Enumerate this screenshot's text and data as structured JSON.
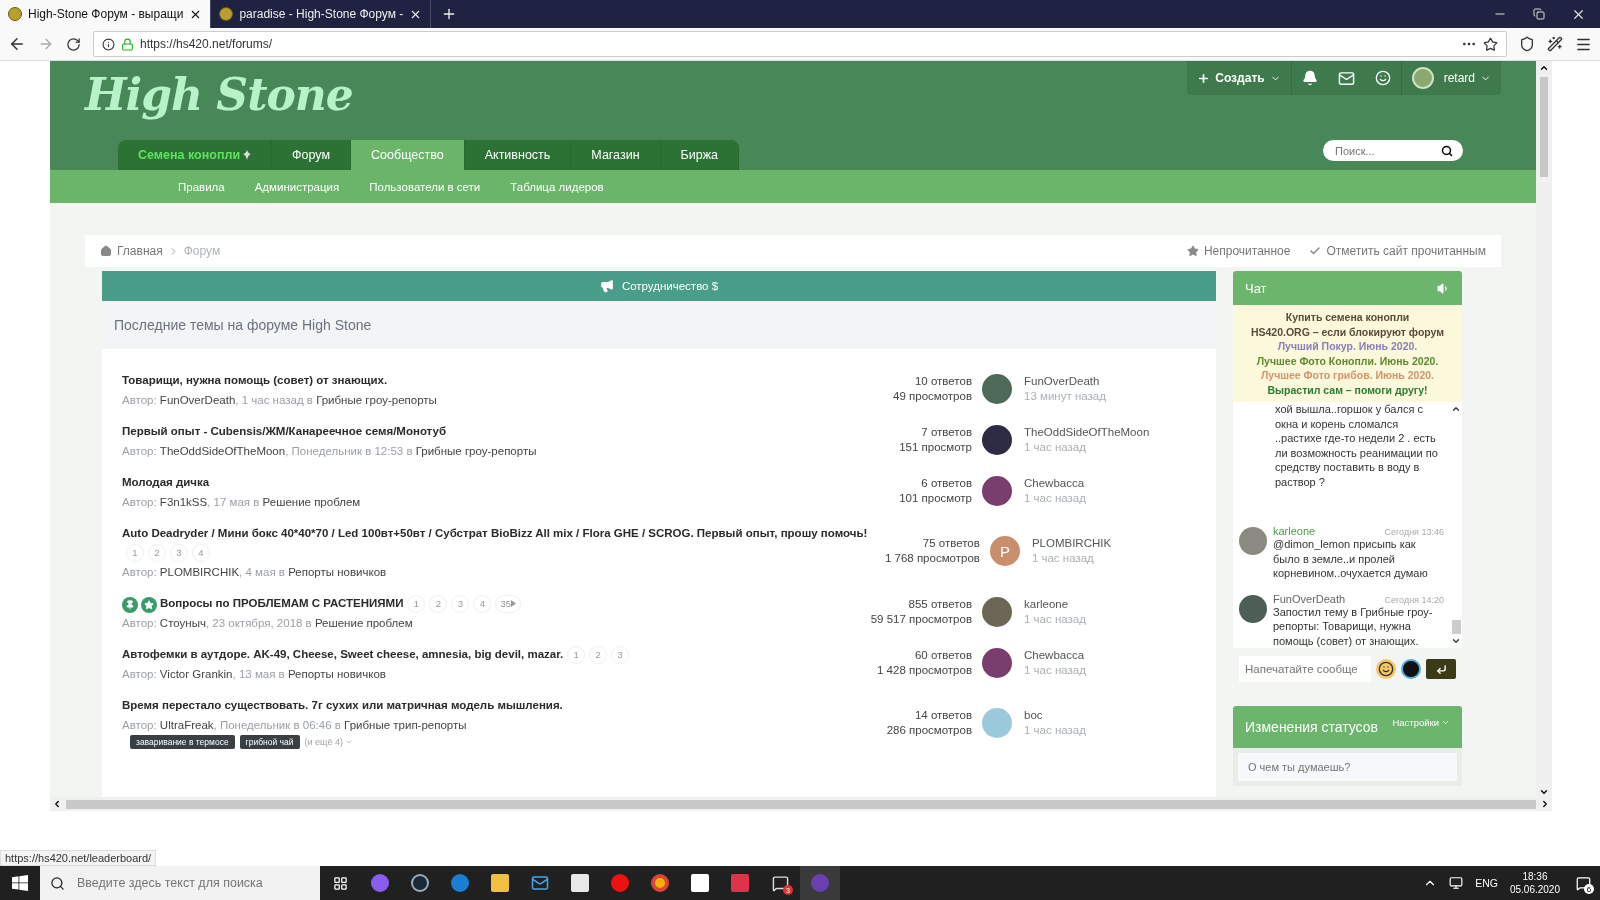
{
  "browser": {
    "tabs": [
      {
        "title": "High-Stone Форум - выращи",
        "selected": true
      },
      {
        "title": "paradise - High-Stone Форум -",
        "selected": false
      }
    ],
    "url": "https://hs420.net/forums/",
    "status_url": "https://hs420.net/leaderboard/"
  },
  "site": {
    "logo": "High Stone",
    "create": "Создать",
    "username": "retard",
    "search_placeholder": "Поиск...",
    "nav": [
      {
        "label": "Семена конопли",
        "kind": "promo",
        "selected": false
      },
      {
        "label": "Форум",
        "kind": "link",
        "selected": false
      },
      {
        "label": "Сообщество",
        "kind": "link",
        "selected": true
      },
      {
        "label": "Активность",
        "kind": "link",
        "selected": false
      },
      {
        "label": "Магазин",
        "kind": "link",
        "selected": false
      },
      {
        "label": "Биржа",
        "kind": "link",
        "selected": false
      }
    ],
    "subnav": [
      "Правила",
      "Администрация",
      "Пользователи в сети",
      "Таблица лидеров"
    ]
  },
  "breadcrumbs": {
    "items": [
      {
        "label": "Главная",
        "kind": "home"
      },
      {
        "label": "Форум",
        "kind": "current"
      }
    ],
    "actions": [
      {
        "label": "Непрочитанное",
        "kind": "star"
      },
      {
        "label": "Отметить сайт прочитанным",
        "kind": "check"
      }
    ]
  },
  "banner": "Сотрудничество $",
  "topics": {
    "title": "Последние темы на форуме High Stone",
    "rows": [
      {
        "title": "Товарищи, нужна помощь (совет) от знающих.",
        "pinned": false,
        "featured": false,
        "pages_more": false,
        "by": "Автор:",
        "author": "FunOverDeath",
        "when": ", 1 час назад в",
        "forum": "Грибные гроу-репорты",
        "replies": "10 ответов",
        "views": "49 просмотров",
        "last_poster": "FunOverDeath",
        "last_time": "13 минут назад"
      },
      {
        "title": "Первый опыт - Cubensis/ЖМ/Канареечное семя/Монотуб",
        "pinned": false,
        "featured": false,
        "pages_more": false,
        "by": "Автор:",
        "author": "TheOddSideOfTheMoon",
        "when": ", Понедельник в 12:53 в",
        "forum": "Грибные гроу-репорты",
        "replies": "7 ответов",
        "views": "151 просмотр",
        "last_poster": "TheOddSideOfTheMoon",
        "last_time": "1 час назад"
      },
      {
        "title": "Молодая дичка",
        "pinned": false,
        "featured": false,
        "pages_more": false,
        "by": "Автор:",
        "author": "F3n1kSS",
        "when": ", 17 мая в",
        "forum": "Решение проблем",
        "replies": "6 ответов",
        "views": "101 просмотр",
        "last_poster": "Chewbacca",
        "last_time": "1 час назад"
      },
      {
        "title": "Auto Deadryder / Мини бокс 40*40*70 / Led 100вт+50вт / Субстрат BioBizz All mix / Flora GHE / SCROG. Первый опыт, прошу помочь!",
        "pages": [
          "1",
          "2",
          "3",
          "4"
        ],
        "pinned": false,
        "featured": false,
        "pages_more": false,
        "by": "Автор:",
        "author": "PLOMBIRCHIK",
        "when": ", 4 мая в",
        "forum": "Репорты новичков",
        "replies": "75 ответов",
        "views": "1 768 просмотров",
        "last_poster": "PLOMBIRCHIK",
        "last_time": "1 час назад",
        "avatar_letter": "P"
      },
      {
        "title": "Вопросы по ПРОБЛЕМАМ С РАСТЕНИЯМИ",
        "pages": [
          "1",
          "2",
          "3",
          "4",
          "35"
        ],
        "pinned": true,
        "featured": true,
        "pages_more": true,
        "by": "Автор:",
        "author": "Стоуныч",
        "when": ", 23 октября, 2018 в",
        "forum": "Решение проблем",
        "replies": "855 ответов",
        "views": "59 517 просмотров",
        "last_poster": "karleone",
        "last_time": "1 час назад"
      },
      {
        "title": "Автофемки в аутдоре. AK-49, Cheese, Sweet cheese, amnesia, big devil, mazar.",
        "pages": [
          "1",
          "2",
          "3"
        ],
        "pinned": false,
        "featured": false,
        "pages_more": false,
        "by": "Автор:",
        "author": "Victor Grankin",
        "when": ", 13 мая в",
        "forum": "Репорты новичков",
        "replies": "60 ответов",
        "views": "1 428 просмотров",
        "last_poster": "Chewbacca",
        "last_time": "1 час назад"
      },
      {
        "title": "Время перестало существовать. 7г сухих или матричная модель мышления.",
        "pinned": false,
        "featured": false,
        "pages_more": false,
        "by": "Автор:",
        "author": "UltraFreak",
        "when": ", Понедельник в 06:46 в",
        "forum": "Грибные трип-репорты",
        "tags": [
          "заваривание в термосе",
          "грибной чай"
        ],
        "more_tags": "(и ещё 4)",
        "replies": "14 ответов",
        "views": "286 просмотров",
        "last_poster": "boc",
        "last_time": "1 час назад"
      }
    ]
  },
  "chat": {
    "title": "Чат",
    "notice": [
      {
        "text": "Купить семена конопли",
        "color": "#5a4a3c"
      },
      {
        "text": "HS420.ORG – если блокируют форум",
        "color": "#5a4a3c"
      },
      {
        "text": "Лучший Покур. Июнь 2020.",
        "color": "#8a80b8"
      },
      {
        "text": "Лучшее Фото Конопли. Июнь 2020.",
        "color": "#5e8a2c"
      },
      {
        "text": "Лучшее Фото грибов. Июнь 2020.",
        "color": "#d49468"
      },
      {
        "text": "Вырастил сам – помоги другу!",
        "color": "#2e7a2e"
      }
    ],
    "messages": [
      {
        "kind": "continued",
        "text": "хой вышла..горшок у бался с окна и корень сломался ..растихе где-то недели 2 . есть ли возможность реанимации по средству поставить в воду в раствор ?"
      },
      {
        "kind": "message",
        "author": "karleone",
        "color": "#4a9a4a",
        "time": "Сегодня 13:46",
        "text": "@dimon_lemon присыпь как было в земле..и пролей корневином..очухается думаю"
      },
      {
        "kind": "message",
        "author": "FunOverDeath",
        "color": "#666666",
        "time": "Сегодня 14:20",
        "text": "Запостил тему в Грибные гроу-репорты: Товарищи, нужна помощь (совет) от знающих."
      }
    ],
    "input_placeholder": "Напечатайте сообще"
  },
  "status_updates": {
    "title": "Изменения статусов",
    "settings": "Настройки",
    "placeholder": "О чем ты думаешь?"
  },
  "taskbar": {
    "search_placeholder": "Введите здесь текст для поиска",
    "app_badge": "3",
    "language": "ENG",
    "time": "18:36",
    "date": "05.06.2020",
    "notifications": "6"
  }
}
